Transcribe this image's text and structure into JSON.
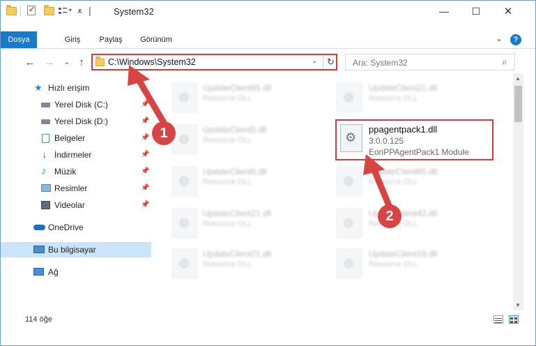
{
  "window": {
    "title": "System32",
    "min": "—",
    "max": "☐",
    "close": "✕"
  },
  "ribbon": {
    "tabs": [
      {
        "label": "Dosya"
      },
      {
        "label": "Giriş"
      },
      {
        "label": "Paylaş"
      },
      {
        "label": "Görünüm"
      }
    ],
    "expand": "⌄",
    "help": "?"
  },
  "nav": {
    "back": "←",
    "forward": "→",
    "recent": "⌄",
    "up": "↑"
  },
  "address": {
    "path": "C:\\Windows\\System32",
    "dropdown": "⌄",
    "refresh": "↻"
  },
  "search": {
    "placeholder": "Ara: System32",
    "icon": "⌕"
  },
  "sidebar": {
    "items": [
      {
        "label": "Hızlı erişim",
        "icon": "star-icon"
      },
      {
        "label": "Yerel Disk (C:)",
        "icon": "drive-icon",
        "pinned": true
      },
      {
        "label": "Yerel Disk (D:)",
        "icon": "drive-icon",
        "pinned": true
      },
      {
        "label": "Belgeler",
        "icon": "documents-icon",
        "pinned": true
      },
      {
        "label": "İndirmeler",
        "icon": "download-icon",
        "pinned": true
      },
      {
        "label": "Müzik",
        "icon": "music-icon",
        "pinned": true
      },
      {
        "label": "Resimler",
        "icon": "pictures-icon",
        "pinned": true
      },
      {
        "label": "Videolar",
        "icon": "videos-icon",
        "pinned": true
      },
      {
        "label": "OneDrive",
        "icon": "cloud-icon"
      },
      {
        "label": "Bu bilgisayar",
        "icon": "computer-icon",
        "selected": true
      },
      {
        "label": "Ağ",
        "icon": "network-icon"
      }
    ]
  },
  "files": [
    {
      "name": "UpdateClient65.dll",
      "desc": "Resource DLL"
    },
    {
      "name": "UpdateClient21.dll",
      "desc": "Resource DLL"
    },
    {
      "name": "UpdateClient5.dll",
      "desc": "Resource DLL"
    },
    {
      "name": "UpdateClient5.dll",
      "desc": "Resource DLL"
    },
    {
      "name": "UpdateClient65.dll",
      "desc": "Resource DLL"
    },
    {
      "name": "UpdateClient21.dll",
      "desc": "Resource DLL"
    },
    {
      "name": "UpdateClient42.dll",
      "desc": "Resource DLL"
    },
    {
      "name": "UpdateClient21.dll",
      "desc": "Resource DLL"
    },
    {
      "name": "UpdateClient19.dll",
      "desc": "Resource DLL"
    }
  ],
  "highlighted_file": {
    "name": "ppagentpack1.dll",
    "version": "3.0.0.125",
    "description": "EonPPAgentPack1 Module"
  },
  "status": {
    "count": "114 öğe"
  },
  "annotations": {
    "badge1": "1",
    "badge2": "2",
    "color": "#d84344"
  }
}
